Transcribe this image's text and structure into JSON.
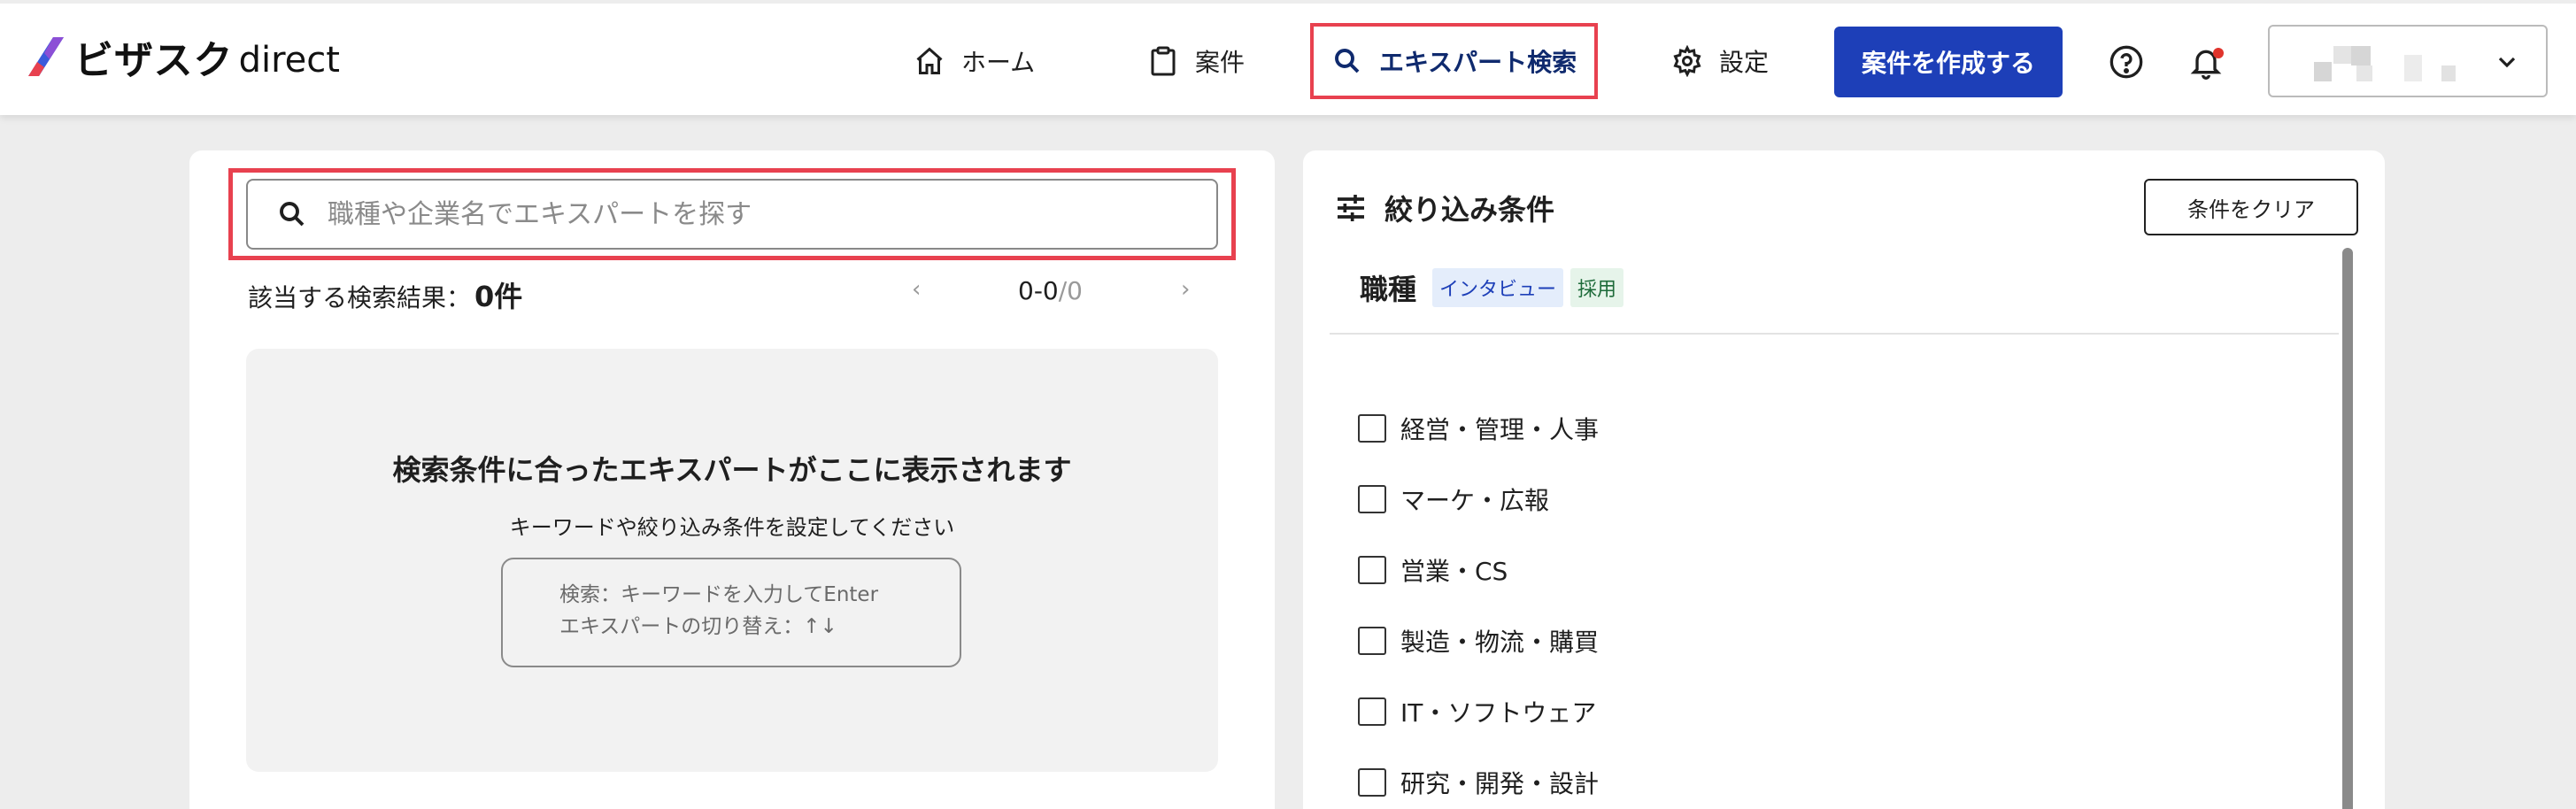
{
  "brand": {
    "name_jp": "ビザスク",
    "name_en": "direct"
  },
  "nav": {
    "items": [
      {
        "label": "ホーム",
        "icon": "home-icon"
      },
      {
        "label": "案件",
        "icon": "clipboard-icon"
      },
      {
        "label": "エキスパート検索",
        "icon": "search-icon",
        "active": true
      },
      {
        "label": "設定",
        "icon": "gear-icon"
      }
    ],
    "create_label": "案件を作成する"
  },
  "search": {
    "placeholder": "職種や企業名でエキスパートを探す",
    "value": ""
  },
  "results": {
    "label": "該当する検索結果：",
    "count": "0件",
    "prev": "‹",
    "next": "›",
    "range": "0-0",
    "total": "/0"
  },
  "empty_state": {
    "title": "検索条件に合ったエキスパートがここに表示されます",
    "subtitle": "キーワードや絞り込み条件を設定してください",
    "hint_line1": "検索：キーワードを入力してEnter",
    "hint_line2": "エキスパートの切り替え：↑↓"
  },
  "filter": {
    "title": "絞り込み条件",
    "clear_label": "条件をクリア",
    "section_title": "職種",
    "tags": [
      "インタビュー",
      "採用"
    ],
    "categories": [
      "経営・管理・人事",
      "マーケ・広報",
      "営業・CS",
      "製造・物流・購買",
      "IT・ソフトウェア",
      "研究・開発・設計"
    ]
  },
  "colors": {
    "accent": "#1d3fb8",
    "highlight": "#e8414f",
    "notification": "#e0342c"
  }
}
